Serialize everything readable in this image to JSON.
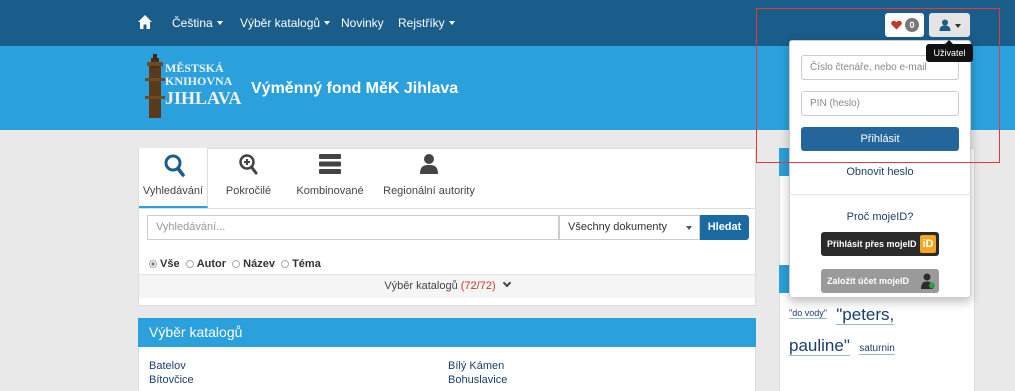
{
  "topbar": {
    "nav": [
      {
        "label": "Čeština"
      },
      {
        "label": "Výběr katalogů"
      },
      {
        "label": "Novinky"
      },
      {
        "label": "Rejstříky"
      }
    ],
    "favorites_count": "0"
  },
  "header": {
    "logo_lines": [
      "MĚSTSKÁ",
      "KNIHOVNA",
      "JIHLAVA"
    ],
    "site_title": "Výměnný fond MěK Jihlava"
  },
  "search": {
    "tabs": [
      {
        "label": "Vyhledávání",
        "icon": "search-icon"
      },
      {
        "label": "Pokročilé",
        "icon": "zoom-in-icon"
      },
      {
        "label": "Kombinované",
        "icon": "stack-icon"
      },
      {
        "label": "Regionální autority",
        "icon": "person-icon"
      }
    ],
    "input_placeholder": "Vyhledávání...",
    "doc_type": "Všechny dokumenty",
    "submit_label": "Hledat",
    "radios": [
      "Vše",
      "Autor",
      "Název",
      "Téma"
    ],
    "catalog_toggle_label": "Výběr katalogů",
    "catalog_toggle_count": "(72/72)"
  },
  "catalogs": {
    "title": "Výběr katalogů",
    "col1": [
      "Batelov",
      "Bítovčice"
    ],
    "col2": [
      "Bílý Kámen",
      "Bohuslavice"
    ]
  },
  "tags": [
    "\"do vody\"",
    "\"peters,",
    "pauline\"",
    "saturnin"
  ],
  "login": {
    "user_placeholder": "Číslo čtenáře, nebo e-mail",
    "pin_placeholder": "PIN (heslo)",
    "submit_label": "Přihlásit",
    "reset_label": "Obnovit heslo",
    "mojeid_question": "Proč mojeID?",
    "mojeid_login_label": "Přihlásit přes mojeID",
    "mojeid_create_label": "Založit účet mojeID",
    "tooltip": "Uživatel"
  },
  "colors": {
    "topbar": "#1a5c8a",
    "banner": "#2aa0dc",
    "primary_button": "#24669b",
    "highlight_box": "#e53935"
  }
}
